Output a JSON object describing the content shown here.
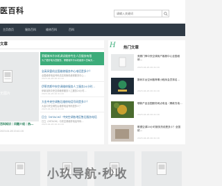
{
  "header": {
    "logo_text": "医百科",
    "search_placeholder": "请输入关键词"
  },
  "nav": {
    "items": [
      {
        "label": "主页首页"
      },
      {
        "label": "服务百科"
      },
      {
        "label": "维修百科"
      },
      {
        "label": "百科"
      }
    ]
  },
  "left": {
    "section_title": "文章",
    "thumb_caption": "无图片",
    "thumb_bar_title": "百科知识｜问题介绍｜热…",
    "thumb_bar_date": "2023-04-26 20:41:16",
    "articles": [
      {
        "title": "荣耀城市冷水机调试维修专业人员服务有限",
        "desc": "为了更好地为您服务，荣耀城市冷水机维修人员每天…",
        "date": "",
        "highlight": true
      },
      {
        "title": "念高风管机全国维修服务中心电话是多少？",
        "desc": "全国维修电话号码念高风管机维修服务中心…",
        "date": "2023-04-26 20:41:16",
        "highlight": false
      },
      {
        "title": "伊莱克斯中央空调维修服务人工服务24小时…",
        "desc": "伊莱克斯中央空调维修服务人工服务24小时…",
        "date": "2023-04-26 20:41:16",
        "highlight": false
      },
      {
        "title": "大金中央空调售后维修电话号码是多少？",
        "desc": "大金中央空调售后维修电话号码是多少？",
        "date": "2023-04-26 20:41:16",
        "highlight": false
      },
      {
        "title": "日立（HITACHI）中央空调各地区售后服务电话",
        "desc": "日立（HITACHI）中央空调维修电话号码…",
        "date": "2023-04-26 20:41:16",
        "highlight": false
      }
    ]
  },
  "right": {
    "hot_letter": "H",
    "hot_title": "热门文章",
    "items": [
      {
        "text": "竞赛门神中央空调用户客服中心全国维修…",
        "date": "2023-04-26 20:41:16"
      },
      {
        "text": "数码平台空间推荐哪小程序会员排名…",
        "date": "2023-04-26 20:41:16"
      },
      {
        "text": "哪款产品全国服务网点电话（哪款充电…",
        "date": "2023-04-26 20:41:16"
      },
      {
        "text": "歌德空调24小时服务热线是多少？全国统…",
        "date": "2023-04-26 20:41:16"
      }
    ]
  },
  "watermark": {
    "text": "小玖导航·秒收"
  },
  "colors": {
    "accent": "#3cac7a",
    "nav_bg": "#2f3a45"
  }
}
